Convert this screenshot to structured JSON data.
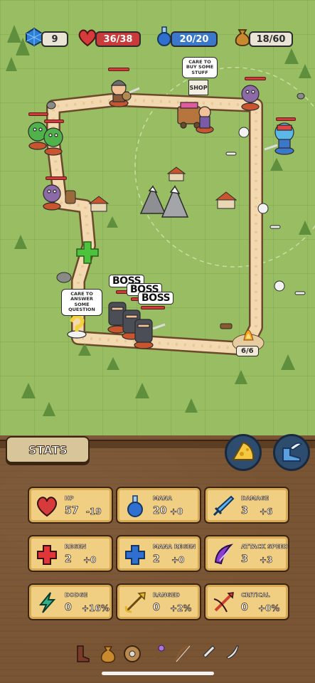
{
  "hud": {
    "gems": "9",
    "hp": "36/38",
    "mana": "20/20",
    "bag": "18/60"
  },
  "map": {
    "shop_bubble": "CARE TO BUY SOME STUFF",
    "shop_sign": "SHOP",
    "quiz_bubble": "CARE TO ANSWER SOME QUESTION",
    "boss_label": "BOSS",
    "camp_counter": "6/6"
  },
  "panel": {
    "title": "STATS"
  },
  "stats": [
    {
      "label": "HP",
      "value": "57",
      "bonus": "-19",
      "icon": "heart-icon",
      "color": "#d63a3a"
    },
    {
      "label": "MANA",
      "value": "20",
      "bonus": "+0",
      "icon": "potion-icon",
      "color": "#2f6fd0"
    },
    {
      "label": "DAMAGE",
      "value": "3",
      "bonus": "+6",
      "icon": "sword-icon",
      "color": "#3a9be0"
    },
    {
      "label": "REGEN",
      "value": "2",
      "bonus": "+0",
      "icon": "red-cross-icon",
      "color": "#e0363a"
    },
    {
      "label": "MANA REGEN",
      "value": "2",
      "bonus": "+0",
      "icon": "blue-cross-icon",
      "color": "#2f6fd0"
    },
    {
      "label": "ATTACK SPEED",
      "value": "3",
      "bonus": "+3",
      "icon": "swift-slash-icon",
      "color": "#8a3fd0"
    },
    {
      "label": "DODGE",
      "value": "0",
      "bonus": "+16%",
      "icon": "lightning-icon",
      "color": "#2fb089"
    },
    {
      "label": "RANGED",
      "value": "0",
      "bonus": "+2%",
      "icon": "arrow-icon",
      "color": "#e8b52a"
    },
    {
      "label": "CRITICAL",
      "value": "0",
      "bonus": "+0%",
      "icon": "crossbow-icon",
      "color": "#d0402f"
    }
  ],
  "inventory": [
    {
      "icon": "boot-icon"
    },
    {
      "icon": "coin-bag-icon"
    },
    {
      "icon": "shield-icon"
    },
    {
      "icon": "staff-icon"
    },
    {
      "icon": "bow-icon"
    },
    {
      "icon": "dagger-icon"
    },
    {
      "icon": "scimitar-icon"
    }
  ]
}
